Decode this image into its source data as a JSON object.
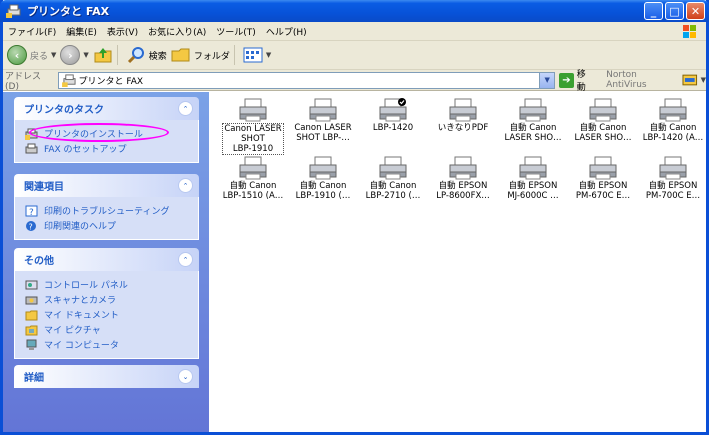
{
  "window": {
    "title": "プリンタと FAX"
  },
  "menu": [
    "ファイル(F)",
    "編集(E)",
    "表示(V)",
    "お気に入り(A)",
    "ツール(T)",
    "ヘルプ(H)"
  ],
  "toolbar": {
    "back": "戻る",
    "search": "検索",
    "folders": "フォルダ"
  },
  "address": {
    "label": "アドレス(D)",
    "value": "プリンタと FAX",
    "go": "移動",
    "norton": "Norton AntiVirus"
  },
  "panels": [
    {
      "title": "プリンタのタスク",
      "items": [
        "プリンタのインストール",
        "FAX のセットアップ"
      ]
    },
    {
      "title": "関連項目",
      "items": [
        "印刷のトラブルシューティング",
        "印刷関連のヘルプ"
      ]
    },
    {
      "title": "その他",
      "items": [
        "コントロール パネル",
        "スキャナとカメラ",
        "マイ ドキュメント",
        "マイ ピクチャ",
        "マイ コンピュータ"
      ]
    },
    {
      "title": "詳細",
      "items": []
    }
  ],
  "printers": [
    {
      "label": "Canon LASER\nSHOT\nLBP-1910",
      "selected": true
    },
    {
      "label": "Canon LASER\nSHOT LBP-…"
    },
    {
      "label": "LBP-1420",
      "default": true
    },
    {
      "label": "いきなりPDF"
    },
    {
      "label": "自動 Canon\nLASER SHO…"
    },
    {
      "label": "自動 Canon\nLASER SHO…"
    },
    {
      "label": "自動 Canon\nLBP-1420 (A…"
    },
    {
      "label": "自動 Canon\nLBP-1510 (A…"
    },
    {
      "label": "自動 Canon\nLBP-1910 (…"
    },
    {
      "label": "自動 Canon\nLBP-2710 (…"
    },
    {
      "label": "自動 EPSON\nLP-8600FX…"
    },
    {
      "label": "自動 EPSON\nMJ-6000C …"
    },
    {
      "label": "自動 EPSON\nPM-670C E…"
    },
    {
      "label": "自動 EPSON\nPM-700C E…"
    }
  ],
  "colors": {
    "accent": "#0a5ce4",
    "annotation": "#ff00ff",
    "link": "#215dc6"
  }
}
